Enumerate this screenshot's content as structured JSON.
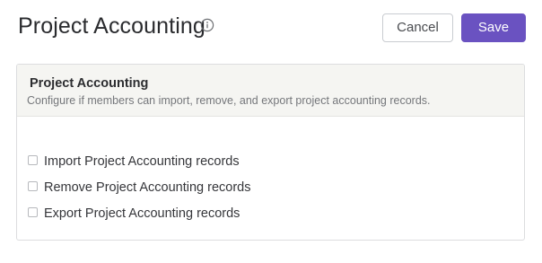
{
  "header": {
    "title": "Project Accounting",
    "info_icon": "info-circle-icon",
    "cancel_label": "Cancel",
    "save_label": "Save"
  },
  "section": {
    "title": "Project Accounting",
    "description": "Configure if members can import, remove, and export project accounting records."
  },
  "options": [
    {
      "label": "Import Project Accounting records",
      "checked": false
    },
    {
      "label": "Remove Project Accounting records",
      "checked": false
    },
    {
      "label": "Export Project Accounting records",
      "checked": false
    }
  ],
  "colors": {
    "primary": "#6a52c1",
    "section_header_bg": "#f5f5f2",
    "border": "#dcdddf"
  }
}
